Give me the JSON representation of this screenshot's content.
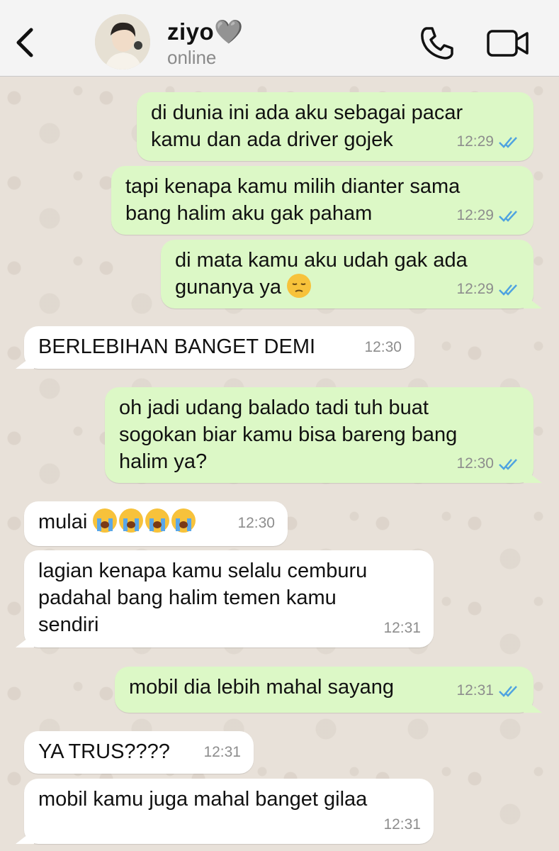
{
  "header": {
    "contact_name": "ziyo🩶",
    "status": "online",
    "icons": [
      "back-chevron-icon",
      "phone-icon",
      "video-call-icon"
    ]
  },
  "messages": [
    {
      "dir": "out",
      "lines": [
        "di dunia ini ada aku sebagai pacar",
        "kamu dan ada driver gojek"
      ],
      "time": "12:29",
      "read": true
    },
    {
      "dir": "out",
      "lines": [
        "tapi kenapa kamu milih dianter sama",
        "bang halim aku gak paham"
      ],
      "time": "12:29",
      "read": true
    },
    {
      "dir": "out",
      "lines": [
        "di mata kamu aku udah gak ada",
        "gunanya ya"
      ],
      "emoji": "pensive-face",
      "time": "12:29",
      "read": true
    },
    {
      "dir": "in",
      "lines": [
        "BERLEBIHAN BANGET DEMI"
      ],
      "time": "12:30"
    },
    {
      "dir": "out",
      "lines": [
        "oh jadi udang balado tadi tuh buat",
        "sogokan biar kamu bisa bareng bang",
        "halim ya?"
      ],
      "time": "12:30",
      "read": true
    },
    {
      "dir": "in",
      "lines": [
        "mulai"
      ],
      "emoji": "loudly-crying-face x4",
      "time": "12:30"
    },
    {
      "dir": "in",
      "lines": [
        "lagian kenapa kamu selalu cemburu",
        "padahal bang halim temen kamu",
        "sendiri"
      ],
      "time": "12:31"
    },
    {
      "dir": "out",
      "lines": [
        "mobil dia lebih mahal sayang"
      ],
      "time": "12:31",
      "read": true
    },
    {
      "dir": "in",
      "lines": [
        "YA TRUS????"
      ],
      "time": "12:31"
    },
    {
      "dir": "in",
      "lines": [
        "mobil kamu juga mahal banget gilaa"
      ],
      "time": "12:31"
    }
  ],
  "colors": {
    "outgoing_bubble": "#dcf8c6",
    "incoming_bubble": "#ffffff",
    "read_ticks": "#4fa3e0",
    "header_bg": "#f4f4f4"
  }
}
